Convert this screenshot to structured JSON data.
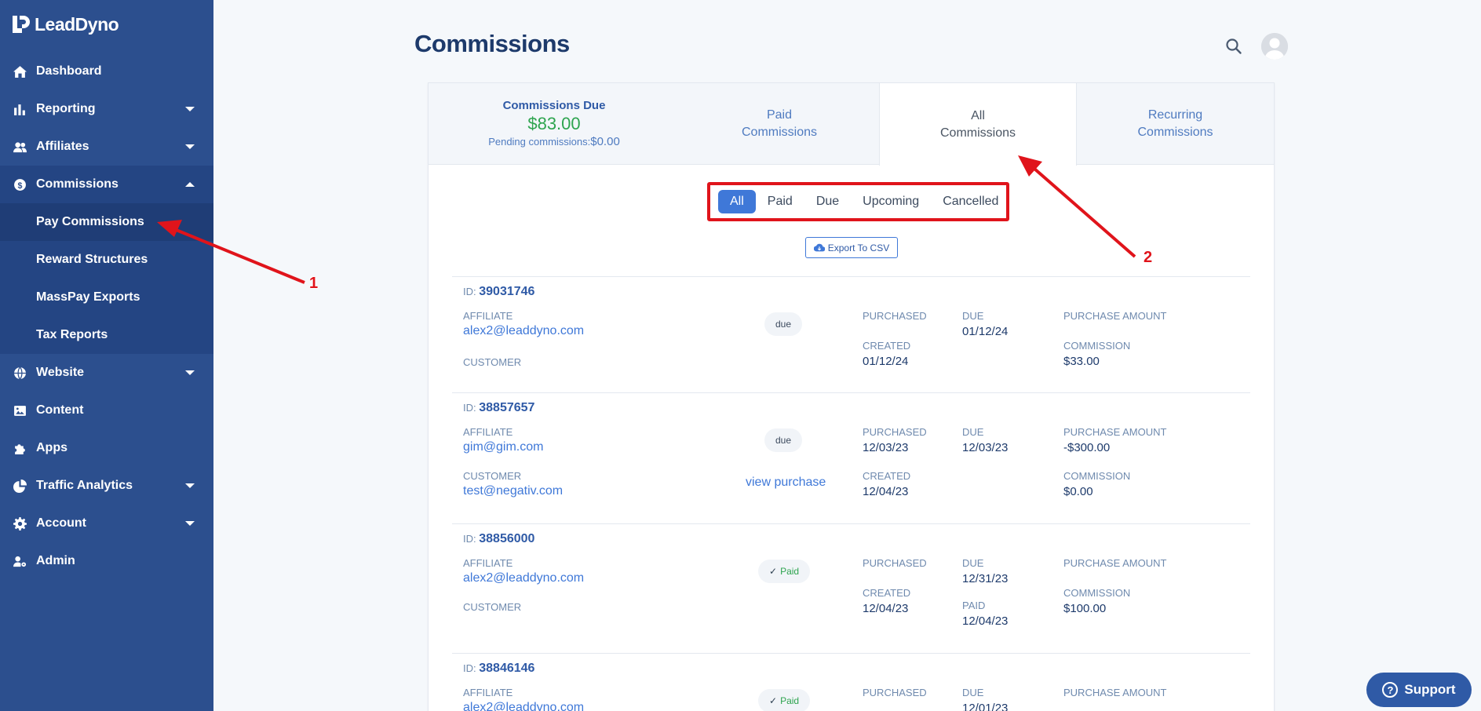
{
  "brand": {
    "name": "LeadDyno"
  },
  "sidebar": {
    "items": [
      {
        "label": "Dashboard",
        "icon": "home-icon"
      },
      {
        "label": "Reporting",
        "icon": "bar-chart-icon"
      },
      {
        "label": "Affiliates",
        "icon": "users-icon"
      },
      {
        "label": "Commissions",
        "icon": "dollar-icon"
      },
      {
        "label": "Website",
        "icon": "globe-icon"
      },
      {
        "label": "Content",
        "icon": "image-icon"
      },
      {
        "label": "Apps",
        "icon": "puzzle-icon"
      },
      {
        "label": "Traffic Analytics",
        "icon": "pie-chart-icon"
      },
      {
        "label": "Account",
        "icon": "gear-icon"
      },
      {
        "label": "Admin",
        "icon": "user-cog-icon"
      }
    ],
    "commissions_sub": [
      {
        "label": "Pay Commissions"
      },
      {
        "label": "Reward Structures"
      },
      {
        "label": "MassPay Exports"
      },
      {
        "label": "Tax Reports"
      }
    ]
  },
  "header": {
    "title": "Commissions"
  },
  "tabs": {
    "due": {
      "title": "Commissions Due",
      "amount": "$83.00",
      "pending_label": "Pending commissions:",
      "pending_value": "$0.00"
    },
    "paid": {
      "line1": "Paid",
      "line2": "Commissions"
    },
    "all": {
      "line1": "All",
      "line2": "Commissions"
    },
    "recurring": {
      "line1": "Recurring",
      "line2": "Commissions"
    }
  },
  "filters": [
    "All",
    "Paid",
    "Due",
    "Upcoming",
    "Cancelled"
  ],
  "export_label": "Export To CSV",
  "labels": {
    "id": "ID:",
    "affiliate": "AFFILIATE",
    "customer": "CUSTOMER",
    "purchased": "PURCHASED",
    "created": "CREATED",
    "due": "DUE",
    "paid": "PAID",
    "purchase_amount": "PURCHASE AMOUNT",
    "commission": "COMMISSION"
  },
  "rows": [
    {
      "id": "39031746",
      "affiliate": "alex2@leaddyno.com",
      "customer": "",
      "status": "due",
      "view_purchase": "",
      "purchased": "",
      "created": "01/12/24",
      "due": "01/12/24",
      "paid": "",
      "purchase_amount": "",
      "commission": "$33.00"
    },
    {
      "id": "38857657",
      "affiliate": "gim@gim.com",
      "customer": "test@negativ.com",
      "status": "due",
      "view_purchase": "view purchase",
      "purchased": "12/03/23",
      "created": "12/04/23",
      "due": "12/03/23",
      "paid": "",
      "purchase_amount": "-$300.00",
      "commission": "$0.00"
    },
    {
      "id": "38856000",
      "affiliate": "alex2@leaddyno.com",
      "customer": "",
      "status": "Paid",
      "view_purchase": "",
      "purchased": "",
      "created": "12/04/23",
      "due": "12/31/23",
      "paid": "12/04/23",
      "purchase_amount": "",
      "commission": "$100.00"
    },
    {
      "id": "38846146",
      "affiliate": "alex2@leaddyno.com",
      "customer": "",
      "status": "Paid",
      "view_purchase": "",
      "purchased": "",
      "created": "",
      "due": "12/01/23",
      "paid": "",
      "purchase_amount": "",
      "commission": ""
    }
  ],
  "annotations": {
    "one": "1",
    "two": "2"
  },
  "support_label": "Support",
  "colors": {
    "sidebar": "#2c4f8e",
    "accent": "#3f78d8",
    "annotation": "#e0141b",
    "money_green": "#2ea44f"
  }
}
